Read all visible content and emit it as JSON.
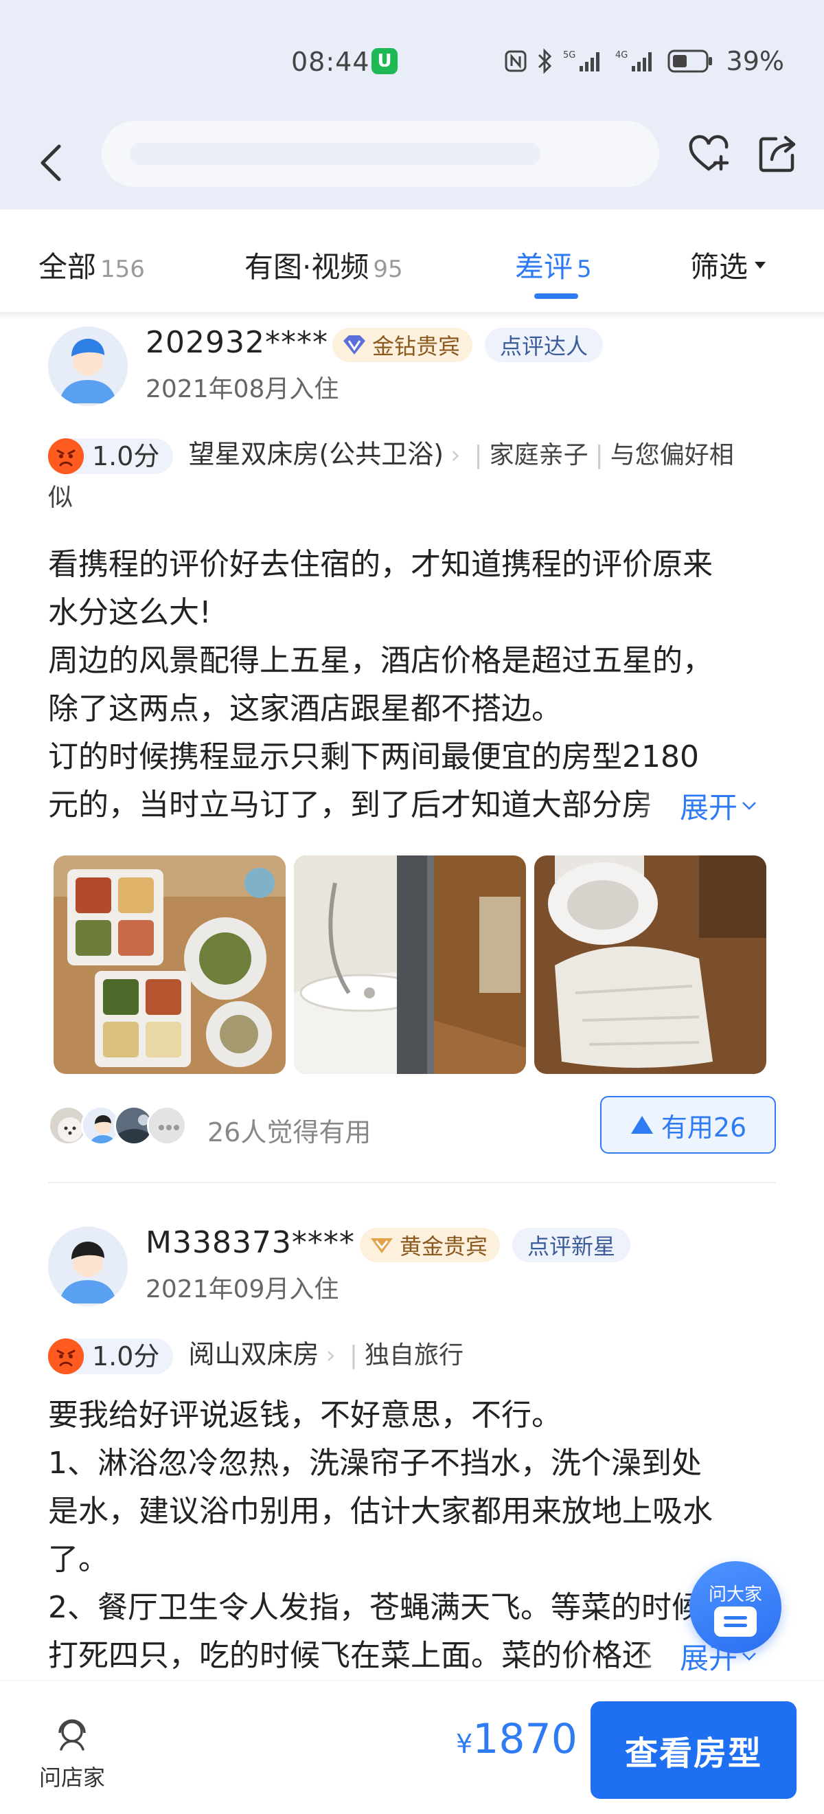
{
  "status_bar": {
    "time": "08:44",
    "app_badge": "U",
    "battery": "39%",
    "icons": [
      "nfc-icon",
      "bluetooth-icon",
      "signal-5g-icon",
      "signal-4g-icon",
      "battery-icon"
    ]
  },
  "nav": {
    "back_icon": "chevron-left-icon",
    "search_placeholder": "",
    "favorite_icon": "heart-plus-icon",
    "share_icon": "share-icon"
  },
  "tabs": [
    {
      "label": "全部",
      "count": "156",
      "active": false
    },
    {
      "label": "有图·视频",
      "count": "95",
      "active": false
    },
    {
      "label": "差评",
      "count": "5",
      "active": true
    }
  ],
  "filter": {
    "label": "筛选"
  },
  "accent": "#2f7bf3",
  "reviews": [
    {
      "username": "202932****",
      "level_badge": "金钻贵宾",
      "tag_badge": "点评达人",
      "stay_date": "2021年08月入住",
      "score": "1.0分",
      "room": "望星双床房(公共卫浴)",
      "trip_type": "家庭亲子",
      "match": "与您偏好相",
      "match_cont": "似",
      "lines": [
        "看携程的评价好去住宿的，才知道携程的评价原来",
        "水分这么大!",
        "周边的风景配得上五星，酒店价格是超过五星的，",
        "除了这两点，这家酒店跟星都不搭边。",
        "订的时候携程显示只剩下两间最便宜的房型2180",
        "元的，当时立马订了，到了后才知道大部分房"
      ],
      "expand": "展开",
      "photos": [
        "photo-dining-plates",
        "photo-shower-curtain",
        "photo-toilet-towel"
      ],
      "helpful_text": "26人觉得有用",
      "useful_button": "有用26"
    },
    {
      "username": "M338373****",
      "level_badge": "黄金贵宾",
      "tag_badge": "点评新星",
      "stay_date": "2021年09月入住",
      "score": "1.0分",
      "room": "阅山双床房",
      "trip_type": "独自旅行",
      "lines": [
        "要我给好评说返钱，不好意思，不行。",
        "1、淋浴忽冷忽热，洗澡帘子不挡水，洗个澡到处",
        "是水，建议浴巾别用，估计大家都用来放地上吸水",
        "了。",
        "2、餐厅卫生令人发指，苍蝇满天飞。等菜的时候",
        "打死四只，吃的时候飞在菜上面。菜的价格还"
      ],
      "expand": "展开"
    }
  ],
  "fab": {
    "label": "问大家"
  },
  "bottom": {
    "ask_label": "问店家",
    "currency": "¥",
    "price": "1870",
    "book_label": "查看房型"
  }
}
